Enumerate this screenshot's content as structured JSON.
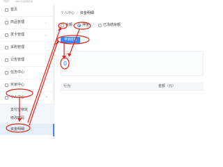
{
  "header": {
    "subtitle": "一体化平台管理系统"
  },
  "sidebar": {
    "items": [
      {
        "label": "首页",
        "expandable": false
      },
      {
        "label": "商品管理",
        "expandable": true
      },
      {
        "label": "发卡管理",
        "expandable": true
      },
      {
        "label": "采购管理",
        "expandable": true
      },
      {
        "label": "公告管理",
        "expandable": true
      },
      {
        "label": "任务中心",
        "expandable": true
      },
      {
        "label": "买家中心",
        "expandable": true
      },
      {
        "label": "个人中心",
        "expandable": true
      }
    ],
    "chevron_right": "›",
    "chevron_up": "^",
    "subitems": [
      {
        "label": "支付宝绑定"
      },
      {
        "label": "修改密码"
      },
      {
        "label": "资金明细"
      }
    ]
  },
  "breadcrumb": {
    "parent": "个人中心",
    "separator": "/",
    "current": "资金明细"
  },
  "filters": {
    "options": [
      {
        "label": "余额",
        "selected": false
      },
      {
        "label": "押金",
        "selected": true
      },
      {
        "label": "已冻结余额",
        "selected": false
      }
    ]
  },
  "actions": {
    "withdraw_label": "申请提现"
  },
  "balance": {
    "label": "余额",
    "value": "0"
  },
  "table": {
    "columns": [
      "行为",
      "金额（元）"
    ]
  },
  "annotation_color": "#e0241b",
  "accent_color": "#3a86ff"
}
